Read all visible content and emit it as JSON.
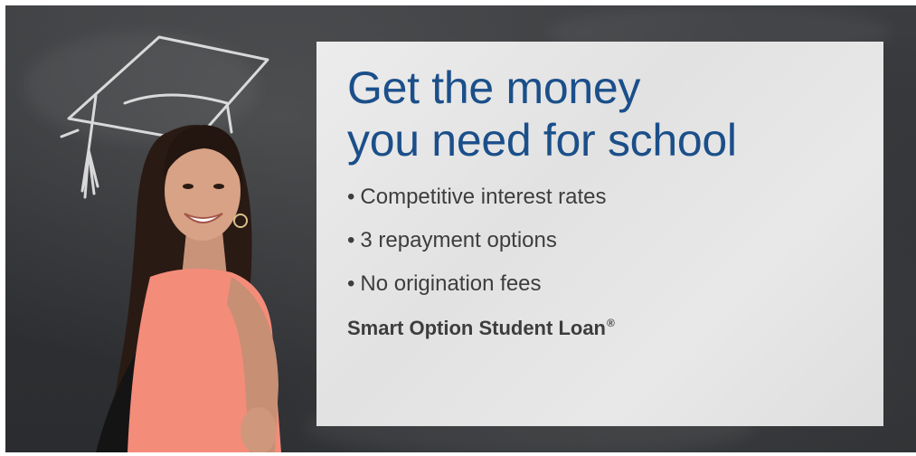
{
  "headline": {
    "line1": "Get the money",
    "line2": "you need for school"
  },
  "features": [
    "Competitive interest rates",
    "3 repayment options",
    "No origination fees"
  ],
  "bullet_char": "•",
  "brand": {
    "name": "Smart Option Student Loan",
    "mark": "®"
  },
  "colors": {
    "headline": "#1b4f8a",
    "body_text": "#3d3d3d",
    "panel": "#e6e6e6",
    "chalkboard": "#2f3134"
  }
}
